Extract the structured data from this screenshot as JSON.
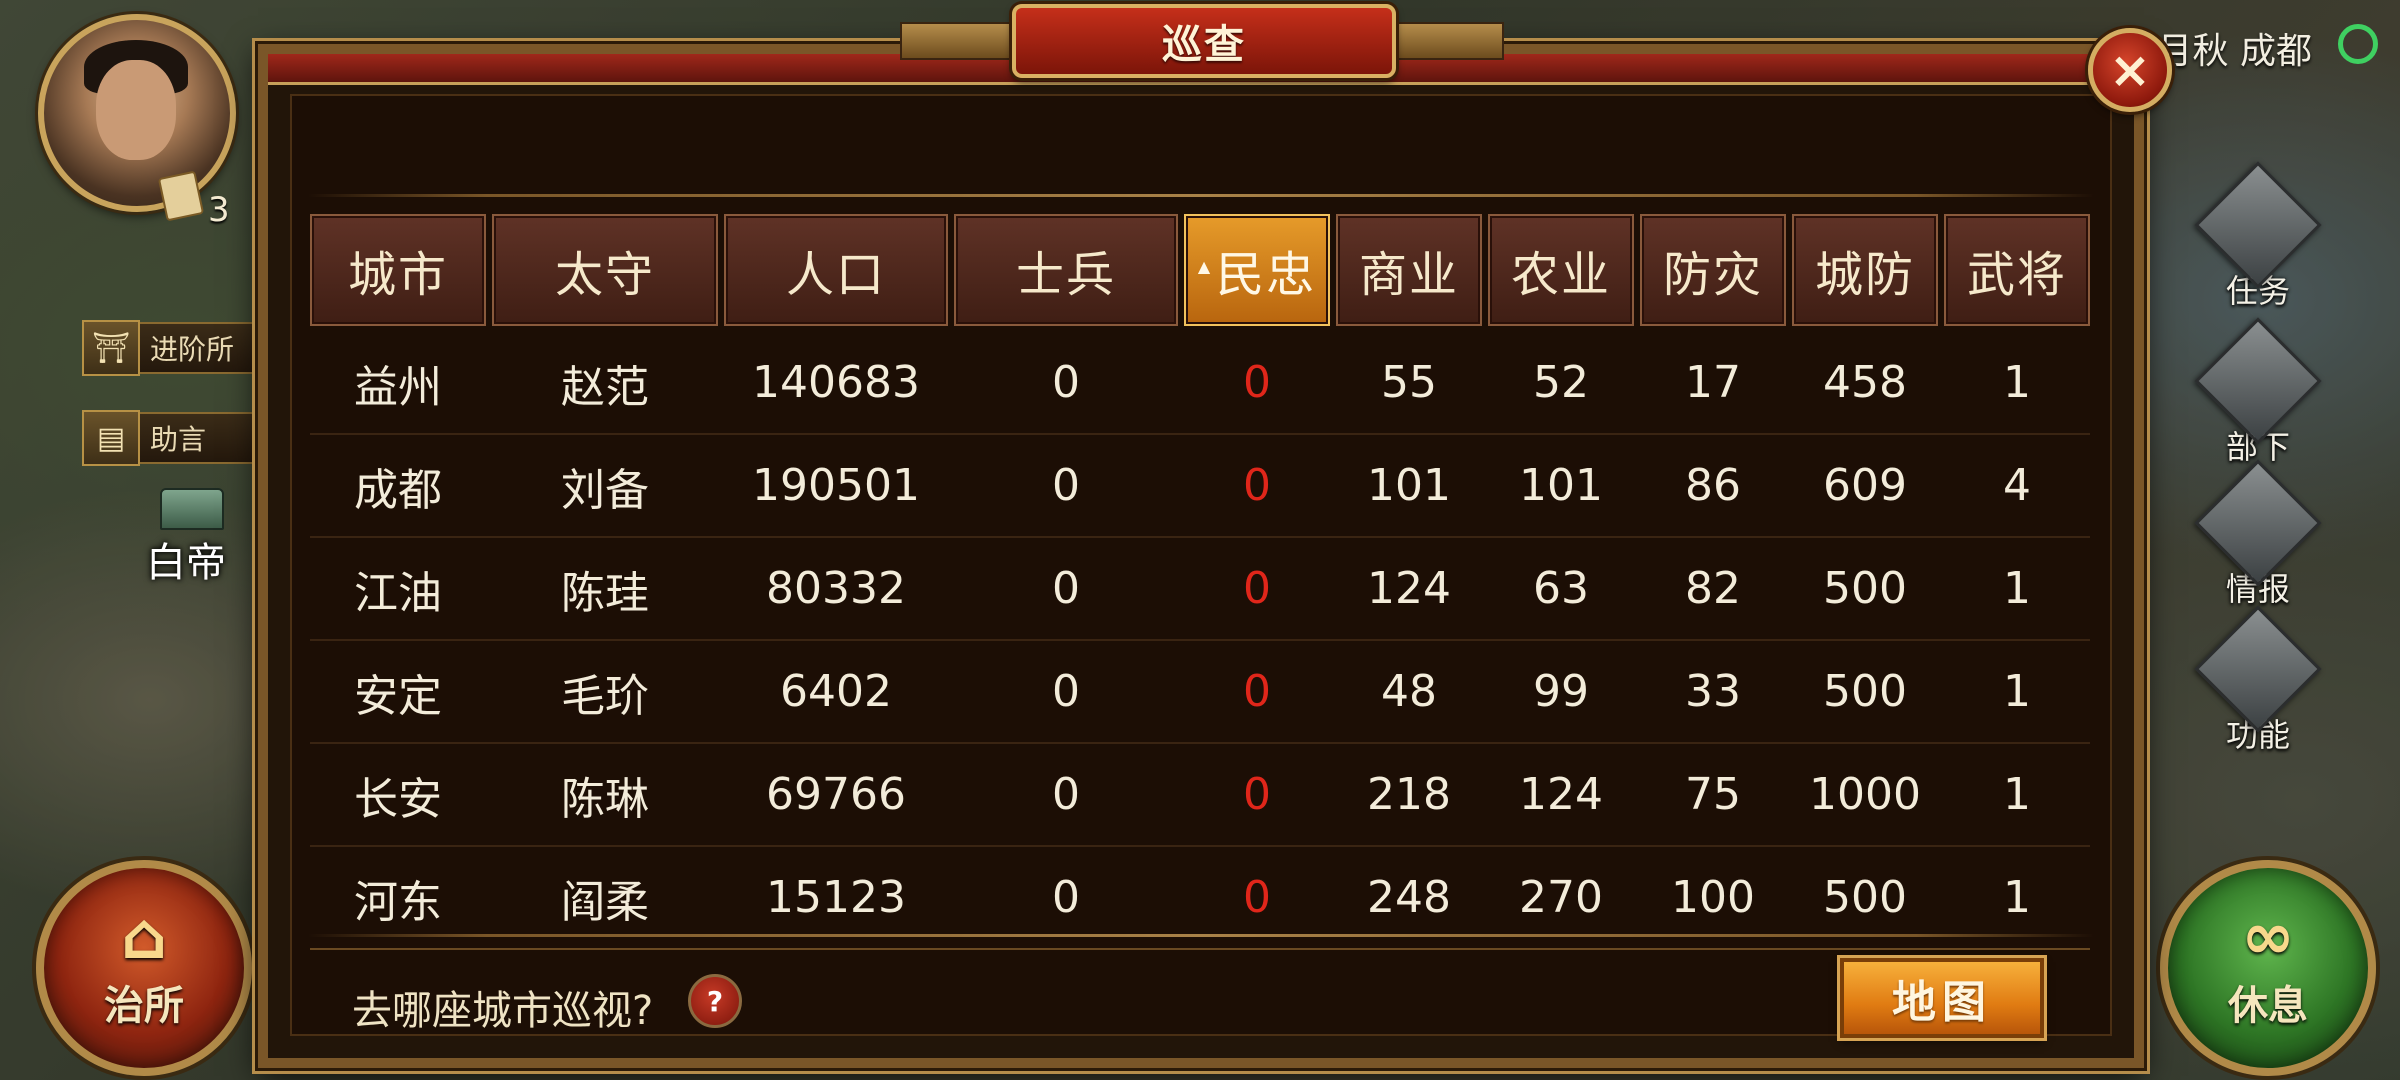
{
  "hud": {
    "level": "3",
    "date_location": "月秋 成都",
    "side_buttons": [
      "进阶所",
      "助言"
    ],
    "map_city_label": "白帝",
    "left_round_button": "治所",
    "right_round_button": "休息",
    "right_menu": [
      "任务",
      "部下",
      "情报",
      "功能"
    ]
  },
  "dialog": {
    "title": "巡查",
    "close_label": "×",
    "question": "去哪座城市巡视?",
    "help_label": "?",
    "map_button": "地图"
  },
  "table": {
    "active_column": "民忠",
    "headers": [
      "城市",
      "太守",
      "人口",
      "士兵",
      "民忠",
      "商业",
      "农业",
      "防灾",
      "城防",
      "武将"
    ],
    "rows": [
      [
        "益州",
        "赵范",
        "140683",
        "0",
        "0",
        "55",
        "52",
        "17",
        "458",
        "1"
      ],
      [
        "成都",
        "刘备",
        "190501",
        "0",
        "0",
        "101",
        "101",
        "86",
        "609",
        "4"
      ],
      [
        "江油",
        "陈珪",
        "80332",
        "0",
        "0",
        "124",
        "63",
        "82",
        "500",
        "1"
      ],
      [
        "安定",
        "毛玠",
        "6402",
        "0",
        "0",
        "48",
        "99",
        "33",
        "500",
        "1"
      ],
      [
        "长安",
        "陈琳",
        "69766",
        "0",
        "0",
        "218",
        "124",
        "75",
        "1000",
        "1"
      ],
      [
        "河东",
        "阎柔",
        "15123",
        "0",
        "0",
        "248",
        "270",
        "100",
        "500",
        "1"
      ]
    ]
  },
  "colors": {
    "loyalty_value": "#e0261a",
    "active_header": "#e69b2a",
    "map_button": "#e07b12",
    "title_plate": "#c52f1a"
  }
}
